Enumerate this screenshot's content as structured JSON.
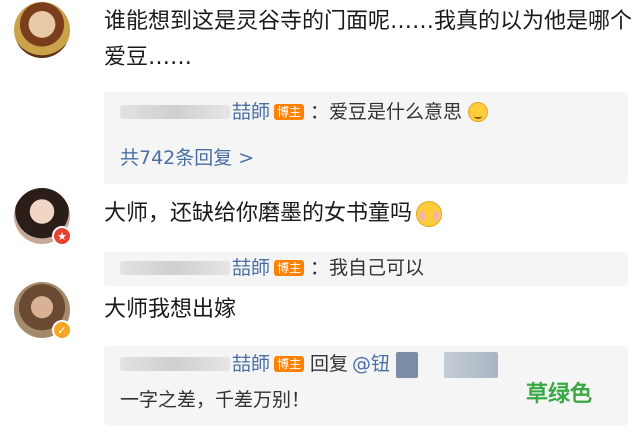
{
  "comments": [
    {
      "text": "谁能想到这是灵谷寺的门面呢……我真的以为他是哪个爱豆……"
    },
    {
      "text": "大师，还缺给你磨墨的女书童吗"
    },
    {
      "text": "大师我想出嫁"
    }
  ],
  "replies": [
    {
      "author_suffix": "喆師",
      "owner_tag": "博主",
      "text": "：爱豆是什么意思",
      "more": "共742条回复 >"
    },
    {
      "author_suffix": "喆師",
      "owner_tag": "博主",
      "text": "：我自己可以"
    },
    {
      "author_suffix": "喆師",
      "owner_tag": "博主",
      "reply_label": "回复",
      "reply_target": "@钮",
      "text": "一字之差，千差万别！"
    }
  ],
  "watermark": "草绿色",
  "icons": [
    "emoji-shy-icon",
    "emoji-blush-icon",
    "verified-red-badge-icon",
    "verified-gold-badge-icon"
  ],
  "colors": {
    "link": "#4a6fa5",
    "owner_tag": "#ff8200",
    "watermark": "#3aa845"
  }
}
